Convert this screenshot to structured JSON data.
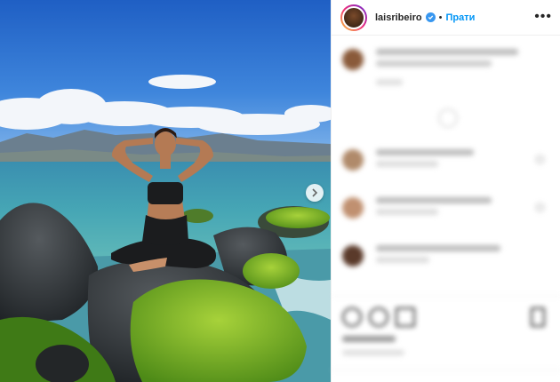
{
  "header": {
    "username": "laisribeiro",
    "follow_label": "Прати",
    "more_label": "•••"
  },
  "colors": {
    "accent": "#0095f6",
    "verified": "#3897f0",
    "text": "#262626",
    "divider": "#efefef"
  },
  "icons": {
    "next": "chevron-right-icon",
    "like": "heart-icon",
    "comment": "comment-icon",
    "share": "paper-plane-icon",
    "save": "bookmark-icon",
    "more": "more-horizontal-icon",
    "verified": "verified-badge-icon"
  }
}
